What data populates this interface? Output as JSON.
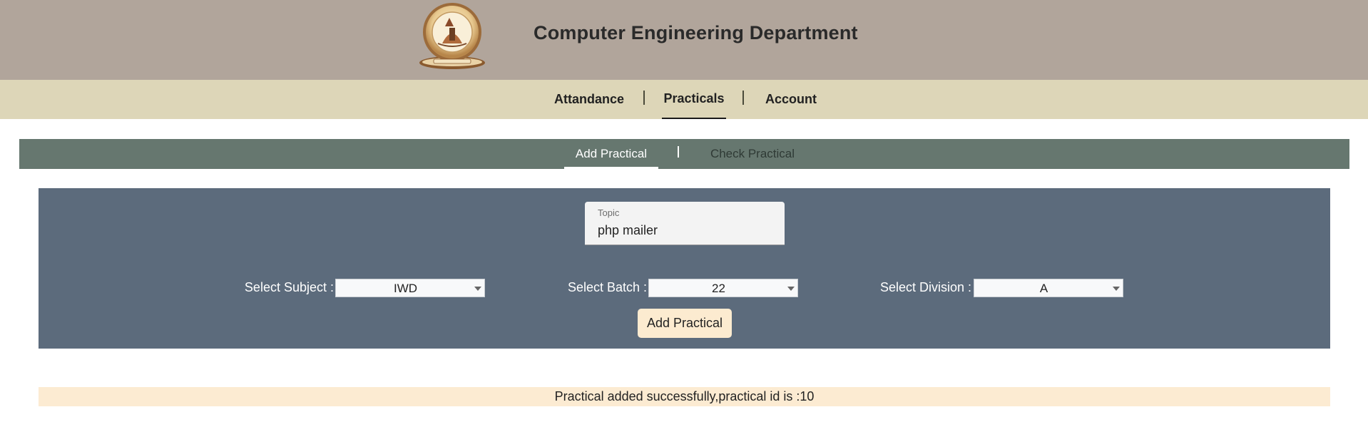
{
  "header": {
    "title": "Computer Engineering Department",
    "logo_icon": "college-crest-logo"
  },
  "nav": {
    "items": [
      {
        "label": "Attandance",
        "active": false
      },
      {
        "label": "Practicals",
        "active": true
      },
      {
        "label": "Account",
        "active": false
      }
    ],
    "separator": "|"
  },
  "subnav": {
    "items": [
      {
        "label": "Add Practical",
        "active": true
      },
      {
        "label": "Check Practical",
        "active": false
      }
    ]
  },
  "form": {
    "topic": {
      "label": "Topic",
      "value": "php mailer"
    },
    "subject": {
      "label": "Select Subject :",
      "value": "IWD"
    },
    "batch": {
      "label": "Select Batch :",
      "value": "22"
    },
    "division": {
      "label": "Select Division :",
      "value": "A"
    },
    "submit_label": "Add Practical"
  },
  "alert": {
    "message": "Practical added successfully,practical id is :10"
  },
  "colors": {
    "header_bg": "#b1a59b",
    "nav_bg": "#ddd6b8",
    "subnav_bg": "#66776f",
    "form_bg": "#5c6b7c",
    "button_bg": "#fcebd0",
    "alert_bg": "#fcebd2"
  }
}
